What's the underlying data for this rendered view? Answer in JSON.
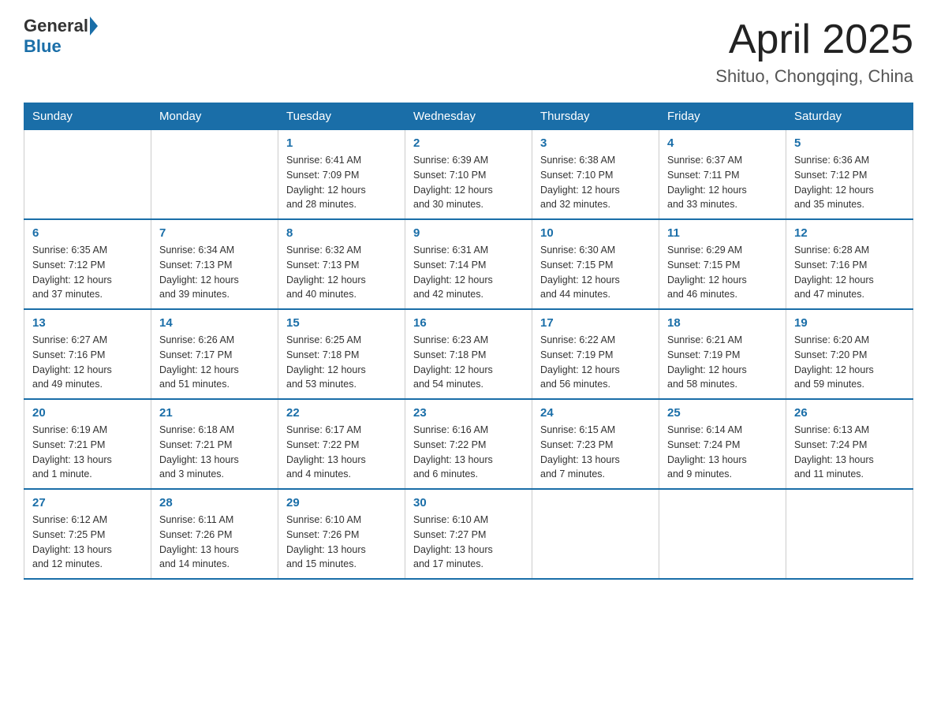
{
  "header": {
    "logo_general": "General",
    "logo_blue": "Blue",
    "title": "April 2025",
    "subtitle": "Shituo, Chongqing, China"
  },
  "columns": [
    "Sunday",
    "Monday",
    "Tuesday",
    "Wednesday",
    "Thursday",
    "Friday",
    "Saturday"
  ],
  "weeks": [
    [
      {
        "day": "",
        "info": ""
      },
      {
        "day": "",
        "info": ""
      },
      {
        "day": "1",
        "info": "Sunrise: 6:41 AM\nSunset: 7:09 PM\nDaylight: 12 hours\nand 28 minutes."
      },
      {
        "day": "2",
        "info": "Sunrise: 6:39 AM\nSunset: 7:10 PM\nDaylight: 12 hours\nand 30 minutes."
      },
      {
        "day": "3",
        "info": "Sunrise: 6:38 AM\nSunset: 7:10 PM\nDaylight: 12 hours\nand 32 minutes."
      },
      {
        "day": "4",
        "info": "Sunrise: 6:37 AM\nSunset: 7:11 PM\nDaylight: 12 hours\nand 33 minutes."
      },
      {
        "day": "5",
        "info": "Sunrise: 6:36 AM\nSunset: 7:12 PM\nDaylight: 12 hours\nand 35 minutes."
      }
    ],
    [
      {
        "day": "6",
        "info": "Sunrise: 6:35 AM\nSunset: 7:12 PM\nDaylight: 12 hours\nand 37 minutes."
      },
      {
        "day": "7",
        "info": "Sunrise: 6:34 AM\nSunset: 7:13 PM\nDaylight: 12 hours\nand 39 minutes."
      },
      {
        "day": "8",
        "info": "Sunrise: 6:32 AM\nSunset: 7:13 PM\nDaylight: 12 hours\nand 40 minutes."
      },
      {
        "day": "9",
        "info": "Sunrise: 6:31 AM\nSunset: 7:14 PM\nDaylight: 12 hours\nand 42 minutes."
      },
      {
        "day": "10",
        "info": "Sunrise: 6:30 AM\nSunset: 7:15 PM\nDaylight: 12 hours\nand 44 minutes."
      },
      {
        "day": "11",
        "info": "Sunrise: 6:29 AM\nSunset: 7:15 PM\nDaylight: 12 hours\nand 46 minutes."
      },
      {
        "day": "12",
        "info": "Sunrise: 6:28 AM\nSunset: 7:16 PM\nDaylight: 12 hours\nand 47 minutes."
      }
    ],
    [
      {
        "day": "13",
        "info": "Sunrise: 6:27 AM\nSunset: 7:16 PM\nDaylight: 12 hours\nand 49 minutes."
      },
      {
        "day": "14",
        "info": "Sunrise: 6:26 AM\nSunset: 7:17 PM\nDaylight: 12 hours\nand 51 minutes."
      },
      {
        "day": "15",
        "info": "Sunrise: 6:25 AM\nSunset: 7:18 PM\nDaylight: 12 hours\nand 53 minutes."
      },
      {
        "day": "16",
        "info": "Sunrise: 6:23 AM\nSunset: 7:18 PM\nDaylight: 12 hours\nand 54 minutes."
      },
      {
        "day": "17",
        "info": "Sunrise: 6:22 AM\nSunset: 7:19 PM\nDaylight: 12 hours\nand 56 minutes."
      },
      {
        "day": "18",
        "info": "Sunrise: 6:21 AM\nSunset: 7:19 PM\nDaylight: 12 hours\nand 58 minutes."
      },
      {
        "day": "19",
        "info": "Sunrise: 6:20 AM\nSunset: 7:20 PM\nDaylight: 12 hours\nand 59 minutes."
      }
    ],
    [
      {
        "day": "20",
        "info": "Sunrise: 6:19 AM\nSunset: 7:21 PM\nDaylight: 13 hours\nand 1 minute."
      },
      {
        "day": "21",
        "info": "Sunrise: 6:18 AM\nSunset: 7:21 PM\nDaylight: 13 hours\nand 3 minutes."
      },
      {
        "day": "22",
        "info": "Sunrise: 6:17 AM\nSunset: 7:22 PM\nDaylight: 13 hours\nand 4 minutes."
      },
      {
        "day": "23",
        "info": "Sunrise: 6:16 AM\nSunset: 7:22 PM\nDaylight: 13 hours\nand 6 minutes."
      },
      {
        "day": "24",
        "info": "Sunrise: 6:15 AM\nSunset: 7:23 PM\nDaylight: 13 hours\nand 7 minutes."
      },
      {
        "day": "25",
        "info": "Sunrise: 6:14 AM\nSunset: 7:24 PM\nDaylight: 13 hours\nand 9 minutes."
      },
      {
        "day": "26",
        "info": "Sunrise: 6:13 AM\nSunset: 7:24 PM\nDaylight: 13 hours\nand 11 minutes."
      }
    ],
    [
      {
        "day": "27",
        "info": "Sunrise: 6:12 AM\nSunset: 7:25 PM\nDaylight: 13 hours\nand 12 minutes."
      },
      {
        "day": "28",
        "info": "Sunrise: 6:11 AM\nSunset: 7:26 PM\nDaylight: 13 hours\nand 14 minutes."
      },
      {
        "day": "29",
        "info": "Sunrise: 6:10 AM\nSunset: 7:26 PM\nDaylight: 13 hours\nand 15 minutes."
      },
      {
        "day": "30",
        "info": "Sunrise: 6:10 AM\nSunset: 7:27 PM\nDaylight: 13 hours\nand 17 minutes."
      },
      {
        "day": "",
        "info": ""
      },
      {
        "day": "",
        "info": ""
      },
      {
        "day": "",
        "info": ""
      }
    ]
  ]
}
